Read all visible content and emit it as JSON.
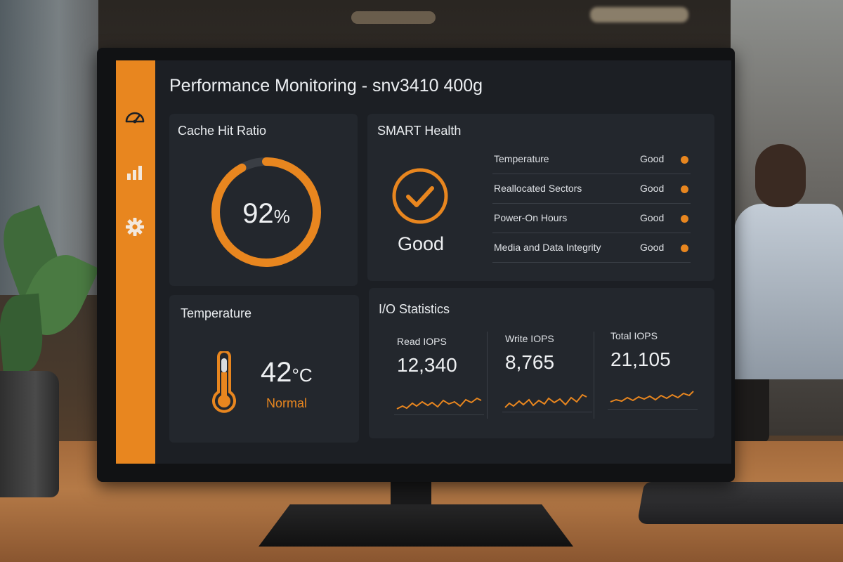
{
  "app": {
    "title": "Performance Monitoring - snv3410 400g"
  },
  "sidebar": {
    "items": [
      {
        "name": "dashboard",
        "icon": "speedometer-icon"
      },
      {
        "name": "statistics",
        "icon": "bar-chart-icon"
      },
      {
        "name": "settings",
        "icon": "gear-icon"
      }
    ]
  },
  "cache": {
    "title": "Cache Hit Ratio",
    "value": "92",
    "unit": "%",
    "ratio": 0.92
  },
  "smart": {
    "title": "SMART Health",
    "overall": "Good",
    "icon": "check-circle-icon",
    "rows": [
      {
        "label": "Temperature",
        "status": "Good"
      },
      {
        "label": "Reallocated Sectors",
        "status": "Good"
      },
      {
        "label": "Power-On Hours",
        "status": "Good"
      },
      {
        "label": "Media and Data Integrity",
        "status": "Good"
      }
    ]
  },
  "temperature": {
    "title": "Temperature",
    "value": "42",
    "unit": "°C",
    "status": "Normal",
    "icon": "thermometer-icon"
  },
  "io": {
    "title": "I/O Statistics",
    "stats": [
      {
        "label": "Read IOPS",
        "value": "12,340"
      },
      {
        "label": "Write IOPS",
        "value": "8,765"
      },
      {
        "label": "Total IOPS",
        "value": "21,105"
      }
    ]
  },
  "colors": {
    "accent": "#e8861f",
    "panel": "#23272d",
    "screen": "#1c1f24",
    "text": "#eceff2"
  }
}
